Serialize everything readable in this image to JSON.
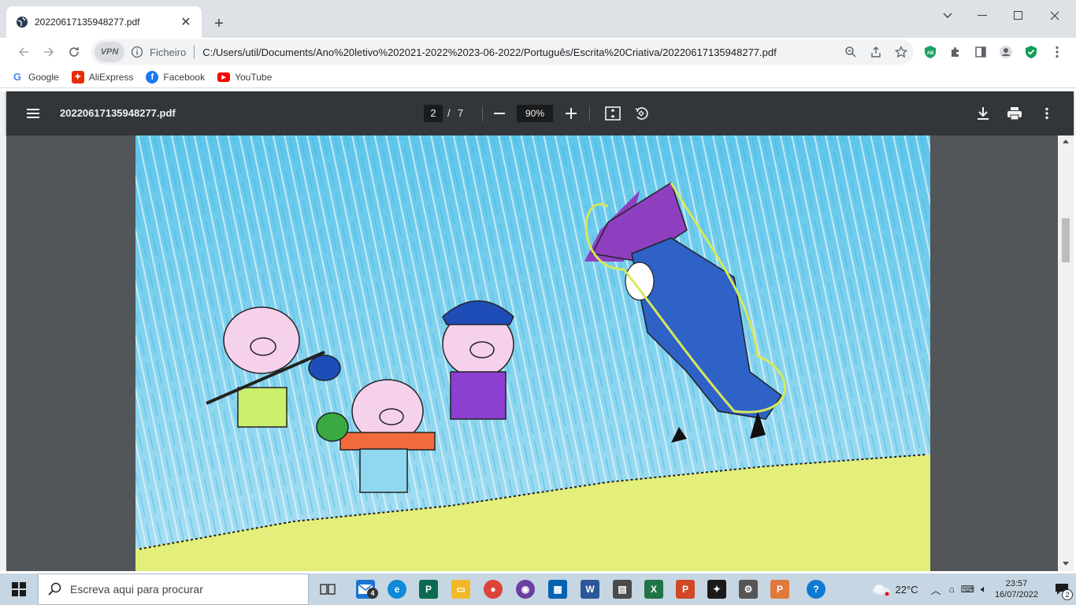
{
  "browser": {
    "tab_title": "20220617135948277.pdf",
    "scheme_label": "Ficheiro",
    "url": "C:/Users/util/Documents/Ano%20letivo%202021-2022%2023-06-2022/Português/Escrita%20Criativa/20220617135948277.pdf",
    "vpn_label": "VPN"
  },
  "bookmarks": [
    {
      "label": "Google",
      "icon": "google-icon"
    },
    {
      "label": "AliExpress",
      "icon": "aliexpress-icon"
    },
    {
      "label": "Facebook",
      "icon": "facebook-icon"
    },
    {
      "label": "YouTube",
      "icon": "youtube-icon"
    }
  ],
  "pdf": {
    "file_name": "20220617135948277.pdf",
    "current_page": "2",
    "page_separator": "/",
    "total_pages": "7",
    "zoom": "90%"
  },
  "taskbar": {
    "search_placeholder": "Escreva aqui para procurar",
    "mail_badge": "4",
    "temperature": "22°C",
    "time": "23:57",
    "date": "16/07/2022",
    "notifications_badge": "2"
  },
  "colors": {
    "tabbar": "#dee1e6",
    "pdf_toolbar": "#323639",
    "viewer_bg": "#525659",
    "taskbar": "#c7d6e3"
  }
}
